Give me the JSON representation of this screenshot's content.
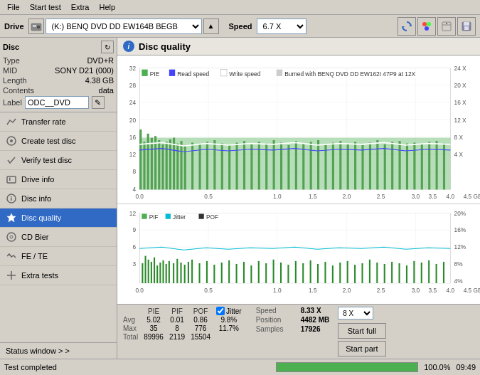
{
  "menubar": {
    "items": [
      "File",
      "Start test",
      "Extra",
      "Help"
    ]
  },
  "drive_bar": {
    "label": "Drive",
    "drive_value": "(K:)  BENQ DVD DD EW164B BEGB",
    "speed_label": "Speed",
    "speed_value": "6.7 X"
  },
  "disc_section": {
    "title": "Disc",
    "type_label": "Type",
    "type_value": "DVD+R",
    "mid_label": "MID",
    "mid_value": "SONY D21 (000)",
    "length_label": "Length",
    "length_value": "4.38 GB",
    "contents_label": "Contents",
    "contents_value": "data",
    "label_label": "Label",
    "label_value": "ODC__DVD"
  },
  "nav_items": [
    {
      "id": "transfer-rate",
      "label": "Transfer rate",
      "icon": "→"
    },
    {
      "id": "create-test-disc",
      "label": "Create test disc",
      "icon": "💿"
    },
    {
      "id": "verify-test-disc",
      "label": "Verify test disc",
      "icon": "✓"
    },
    {
      "id": "drive-info",
      "label": "Drive info",
      "icon": "i"
    },
    {
      "id": "disc-info",
      "label": "Disc info",
      "icon": "📋"
    },
    {
      "id": "disc-quality",
      "label": "Disc quality",
      "icon": "★",
      "active": true
    },
    {
      "id": "cd-bier",
      "label": "CD Bier",
      "icon": "🍺"
    },
    {
      "id": "fe-te",
      "label": "FE / TE",
      "icon": "~"
    },
    {
      "id": "extra-tests",
      "label": "Extra tests",
      "icon": "+"
    }
  ],
  "status_window": "Status window > >",
  "dq_title": "Disc quality",
  "chart1": {
    "legend": [
      "PIE",
      "Read speed",
      "Write speed",
      "Burned with BENQ DVD DD EW162I 47P9 at 12X"
    ],
    "x_max": "4.5 GB",
    "y_right_labels": [
      "24 X",
      "20 X",
      "16 X",
      "12 X",
      "8 X",
      "4 X"
    ],
    "y_left_labels": [
      "32",
      "28",
      "24",
      "20",
      "16",
      "12",
      "8",
      "4"
    ]
  },
  "chart2": {
    "legend": [
      "PIF",
      "Jitter",
      "POF"
    ],
    "x_max": "4.5 GB",
    "y_right_labels": [
      "20%",
      "16%",
      "12%",
      "8%",
      "4%"
    ],
    "y_left_labels": [
      "12",
      "9",
      "6",
      "3"
    ]
  },
  "stats": {
    "col_headers": [
      "PIE",
      "PIF",
      "POF",
      "Jitter"
    ],
    "rows": [
      {
        "label": "Avg",
        "pie": "5.02",
        "pif": "0.01",
        "pof": "0.86",
        "jitter": "9.8%"
      },
      {
        "label": "Max",
        "pie": "35",
        "pif": "8",
        "pof": "776",
        "jitter": "11.7%"
      },
      {
        "label": "Total",
        "pie": "89996",
        "pif": "2119",
        "pof": "15504",
        "jitter": ""
      }
    ],
    "jitter_checked": true,
    "speed_label": "Speed",
    "speed_value": "8.33 X",
    "position_label": "Position",
    "position_value": "4482 MB",
    "samples_label": "Samples",
    "samples_value": "17926",
    "speed_dropdown": "8 X",
    "btn_start_full": "Start full",
    "btn_start_part": "Start part"
  },
  "statusbar": {
    "text": "Test completed",
    "progress": 100.0,
    "progress_label": "100.0%",
    "time": "09:49"
  }
}
